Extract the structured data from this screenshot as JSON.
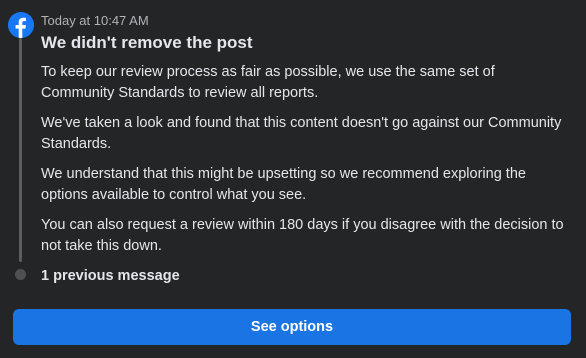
{
  "header": {
    "logo_icon": "facebook-logo-icon",
    "timestamp": "Today at 10:47 AM",
    "title": "We didn't remove the post"
  },
  "message": {
    "paragraphs": [
      "To keep our review process as fair as possible, we use the same set of Community Standards to review all reports.",
      "We've taken a look and found that this content doesn't go against our Community Standards.",
      "We understand that this might be upsetting so we recommend exploring the options available to control what you see.",
      "You can also request a review within 180 days if you disagree with the decision to not take this down."
    ]
  },
  "thread": {
    "previous_label": "1 previous message"
  },
  "actions": {
    "see_options_label": "See options"
  },
  "colors": {
    "background": "#242526",
    "brand": "#1877f2",
    "button": "#1b74e4",
    "text_primary": "#e4e6eb",
    "text_secondary": "#b0b3b8"
  }
}
